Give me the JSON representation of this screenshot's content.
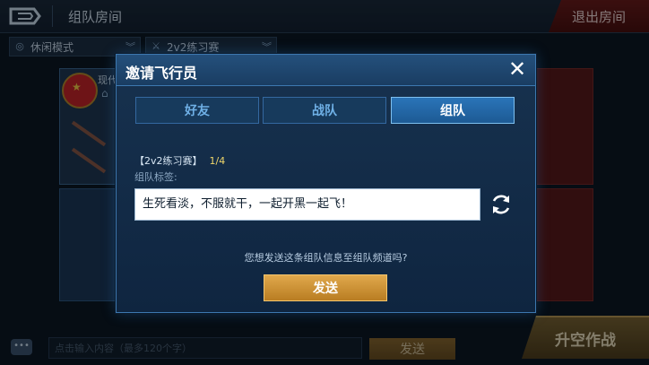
{
  "header": {
    "title": "组队房间",
    "exit_label": "退出房间"
  },
  "mode_bar": {
    "mode": "休闲模式",
    "match_type": "2v2练习赛"
  },
  "player_card": {
    "name": "现代"
  },
  "chat": {
    "placeholder": "点击输入内容（最多120个字）",
    "send_label": "发送"
  },
  "launch_label": "升空作战",
  "modal": {
    "title": "邀请飞行员",
    "close_icon": "close-icon",
    "tabs": [
      {
        "label": "好友",
        "active": false
      },
      {
        "label": "战队",
        "active": false
      },
      {
        "label": "组队",
        "active": true
      }
    ],
    "match_label": "【2v2练习赛】",
    "match_count": "1/4",
    "tag_label": "组队标签:",
    "message": "生死看淡，不服就干，一起开黑一起飞！",
    "refresh_icon": "refresh-icon",
    "prompt": "您想发送这条组队信息至组队频道吗?",
    "send_label": "发送"
  },
  "colors": {
    "accent": "#3d78b0",
    "send_button": "#d59a3e",
    "exit_button": "#6b1c1c",
    "count_highlight": "#f0d76a"
  }
}
